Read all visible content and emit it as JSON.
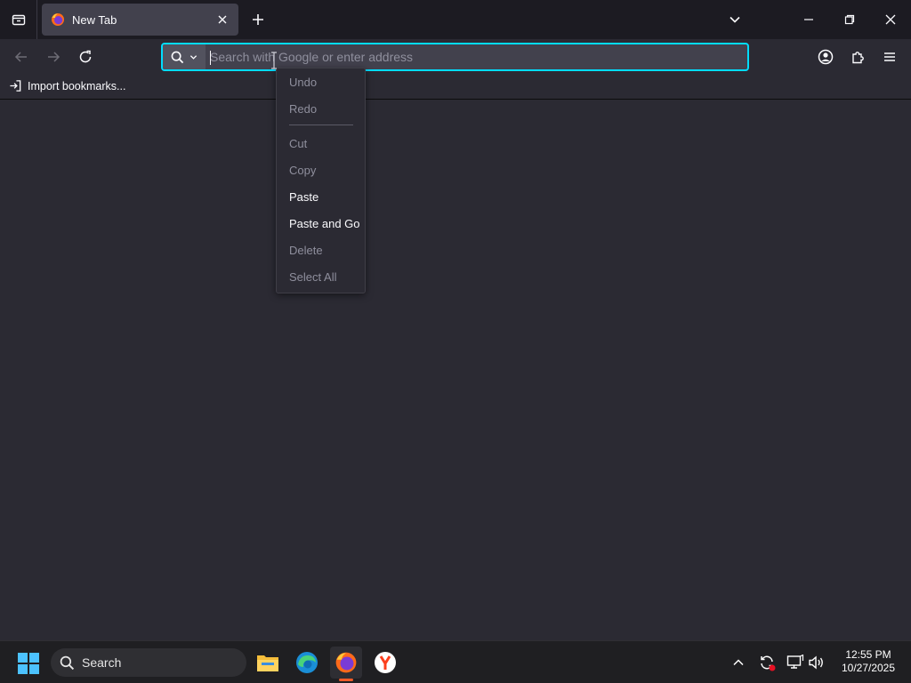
{
  "tab": {
    "title": "New Tab"
  },
  "urlbar": {
    "placeholder": "Search with Google or enter address",
    "value": ""
  },
  "bookmarks": {
    "import_label": "Import bookmarks..."
  },
  "context_menu": {
    "items": [
      {
        "label": "Undo",
        "enabled": false
      },
      {
        "label": "Redo",
        "enabled": false
      },
      {
        "label": "Cut",
        "enabled": false
      },
      {
        "label": "Copy",
        "enabled": false
      },
      {
        "label": "Paste",
        "enabled": true
      },
      {
        "label": "Paste and Go",
        "enabled": true
      },
      {
        "label": "Delete",
        "enabled": false
      },
      {
        "label": "Select All",
        "enabled": false
      }
    ]
  },
  "taskbar": {
    "search_label": "Search",
    "time": "12:55 PM",
    "date": "10/27/2025"
  },
  "colors": {
    "accent": "#00ddff",
    "tab_bg": "#42414d",
    "toolbar_bg": "#2b2a33",
    "tabstrip_bg": "#1c1b22"
  },
  "icons": {
    "tab_overview": "tab-overview-icon",
    "favicon": "firefox-icon",
    "close": "close-icon",
    "new_tab": "plus-icon",
    "list_tabs": "chevron-down-icon",
    "minimize": "minimize-icon",
    "restore": "restore-icon",
    "window_close": "close-icon",
    "back": "arrow-left-icon",
    "forward": "arrow-right-icon",
    "reload": "reload-icon",
    "search": "search-icon",
    "account": "account-icon",
    "extensions": "puzzle-icon",
    "menu": "hamburger-icon",
    "import": "import-icon"
  }
}
